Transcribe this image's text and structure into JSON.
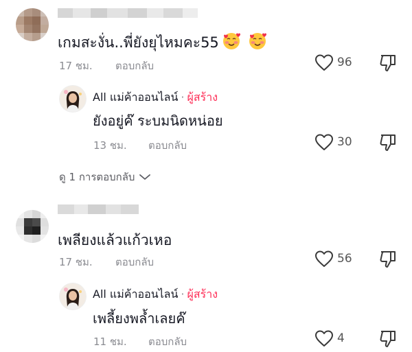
{
  "comments": [
    {
      "text": "เกมสะงั่น..พี่ยังยุไหมคะ55",
      "emojis": [
        "smiling-face-with-hearts-icon",
        "smiling-face-with-hearts-icon"
      ],
      "time": "17 ชม.",
      "reply_label": "ตอบกลับ",
      "likes": "96",
      "reply": {
        "author": "All แม่ค้าออนไลน์",
        "dot": "·",
        "creator_badge": "ผู้สร้าง",
        "text": "ยังอยู่ค๊ ระบมนิดหน่อย",
        "time": "13 ชม.",
        "reply_label": "ตอบกลับ",
        "likes": "30"
      },
      "view_replies": "ดู 1 การตอบกลับ"
    },
    {
      "text": "เพลียงแล้วแก้วเหอ",
      "time": "17 ชม.",
      "reply_label": "ตอบกลับ",
      "likes": "56",
      "reply": {
        "author": "All แม่ค้าออนไลน์",
        "dot": "·",
        "creator_badge": "ผู้สร้าง",
        "text": "เพลี้ยงพล้ำเลยค๊",
        "time": "11 ชม.",
        "reply_label": "ตอบกลับ",
        "likes": "4"
      }
    }
  ],
  "colors": {
    "creator": "#fe2c55",
    "meta": "#8a8b91",
    "text": "#161823"
  }
}
